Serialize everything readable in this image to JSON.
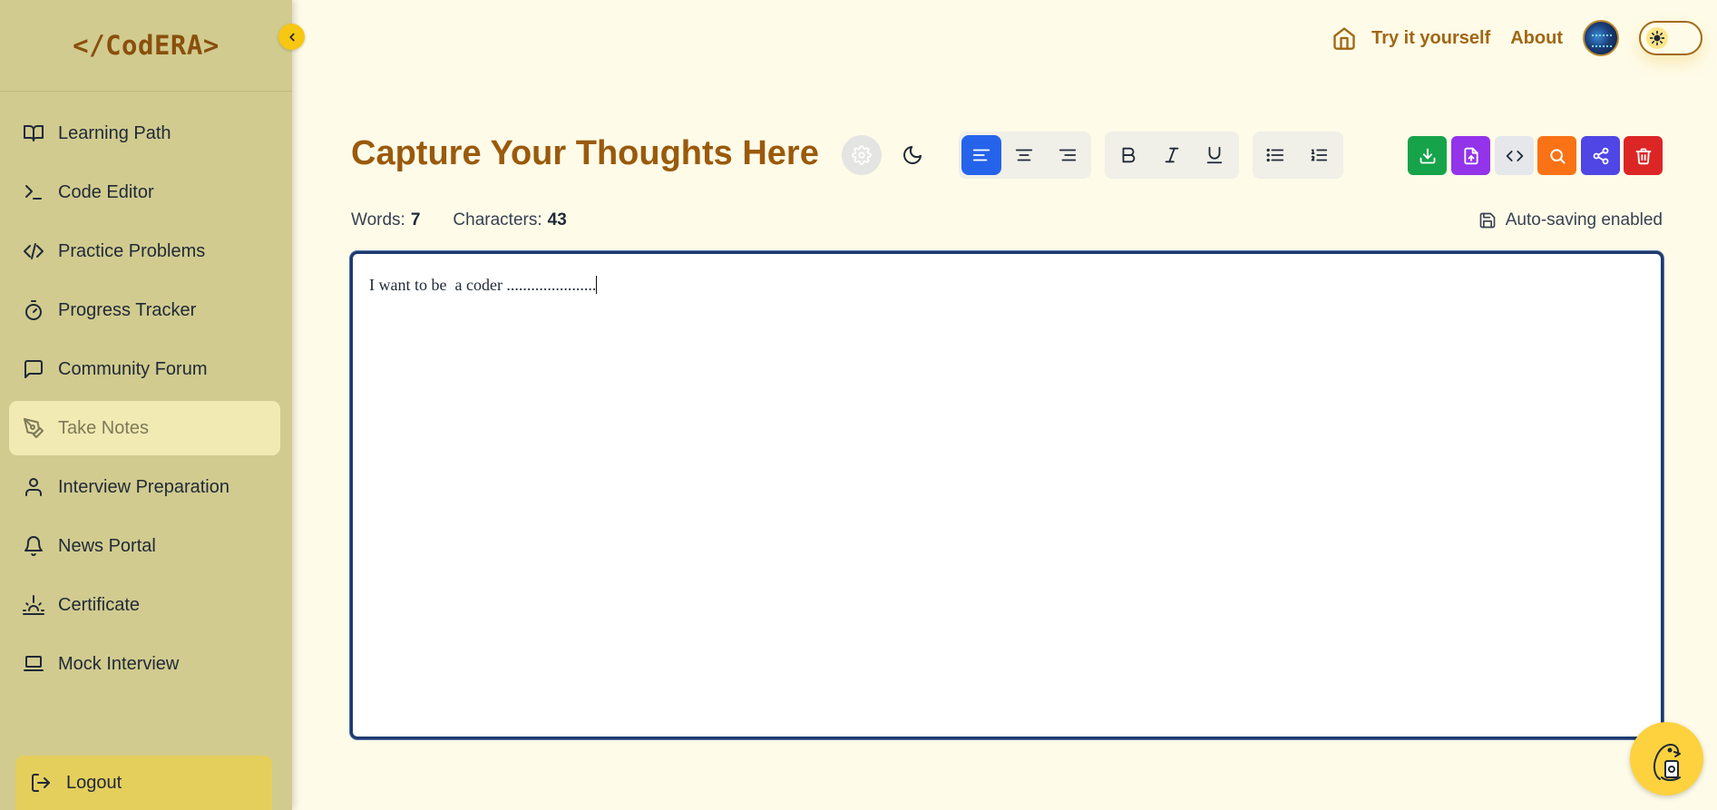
{
  "brand": {
    "logo_text": "</CodERA>"
  },
  "sidebar": {
    "items": [
      {
        "label": "Learning Path",
        "icon": "book-open-icon"
      },
      {
        "label": "Code Editor",
        "icon": "terminal-icon"
      },
      {
        "label": "Practice Problems",
        "icon": "code-icon"
      },
      {
        "label": "Progress Tracker",
        "icon": "timer-icon"
      },
      {
        "label": "Community Forum",
        "icon": "message-square-icon"
      },
      {
        "label": "Take Notes",
        "icon": "pen-tool-icon",
        "active": true
      },
      {
        "label": "Interview Preparation",
        "icon": "user-icon"
      },
      {
        "label": "News Portal",
        "icon": "bell-icon"
      },
      {
        "label": "Certificate",
        "icon": "sunrise-icon"
      },
      {
        "label": "Mock Interview",
        "icon": "laptop-icon"
      }
    ],
    "logout_label": "Logout"
  },
  "header": {
    "try_label": "Try it yourself",
    "about_label": "About"
  },
  "main": {
    "title": "Capture Your Thoughts Here",
    "stats": {
      "words_label": "Words:",
      "words_value": "7",
      "chars_label": "Characters:",
      "chars_value": "43"
    },
    "autosave_label": "Auto-saving enabled",
    "editor_text": "I want to be  a coder ......................"
  },
  "colors": {
    "sidebar_bg": "#d1cb8f",
    "page_bg": "#fefbe8",
    "accent_brown": "#9a5a0c",
    "align_active": "#2563eb",
    "download": "#16a34a",
    "import": "#9333ea",
    "code_toggle": "#e5e7eb",
    "search": "#f97316",
    "share": "#4f46e5",
    "delete": "#dc2626"
  }
}
